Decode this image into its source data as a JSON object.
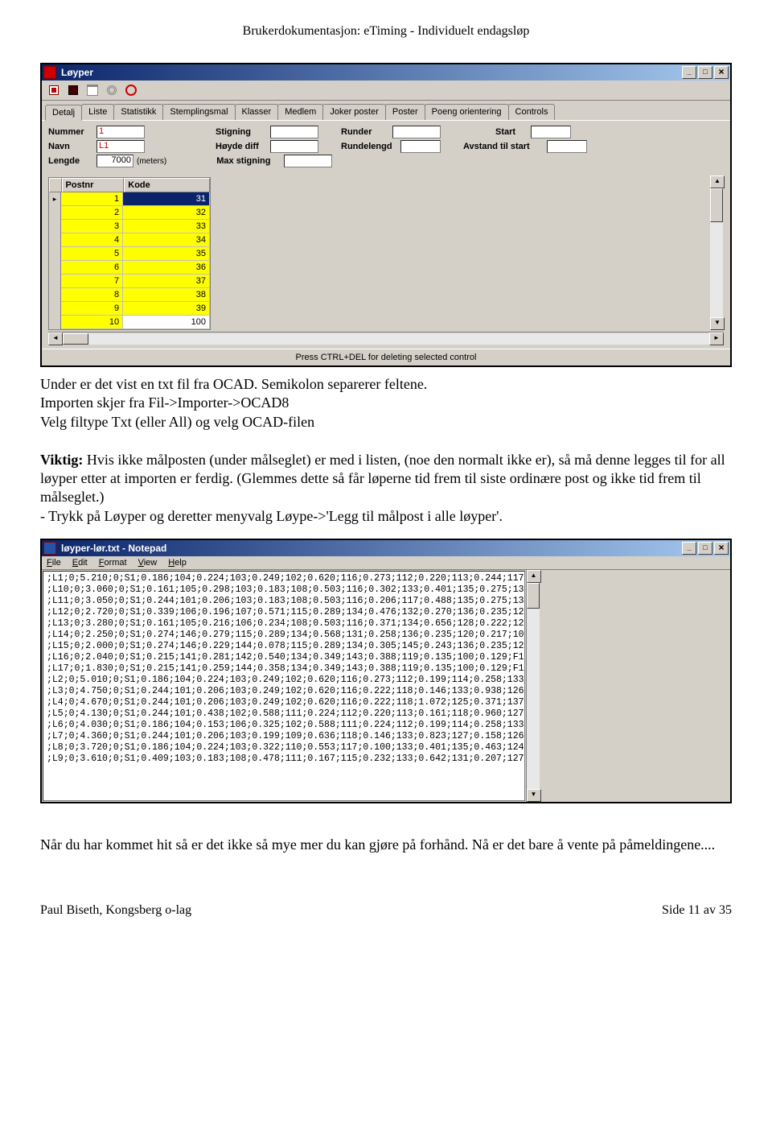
{
  "doc_header": "Brukerdokumentasjon: eTiming - Individuelt endagsløp",
  "win1": {
    "title": "Løyper",
    "tabs": [
      "Detalj",
      "Liste",
      "Statistikk",
      "Stemplingsmal",
      "Klasser",
      "Medlem",
      "Joker poster",
      "Poster",
      "Poeng orientering",
      "Controls"
    ],
    "labels": {
      "nummer": "Nummer",
      "navn": "Navn",
      "lengde": "Lengde",
      "meters": "(meters)",
      "stigning": "Stigning",
      "hoyde": "Høyde diff",
      "maxstig": "Max stigning",
      "runder": "Runder",
      "rundelengd": "Rundelengd",
      "start": "Start",
      "avstand": "Avstand til start"
    },
    "values": {
      "nummer": "1",
      "navn": "L1",
      "lengde": "7000"
    },
    "grid_headers": [
      "Postnr",
      "Kode"
    ],
    "grid_rows": [
      {
        "p": "1",
        "k": "31"
      },
      {
        "p": "2",
        "k": "32"
      },
      {
        "p": "3",
        "k": "33"
      },
      {
        "p": "4",
        "k": "34"
      },
      {
        "p": "5",
        "k": "35"
      },
      {
        "p": "6",
        "k": "36"
      },
      {
        "p": "7",
        "k": "37"
      },
      {
        "p": "8",
        "k": "38"
      },
      {
        "p": "9",
        "k": "39"
      },
      {
        "p": "10",
        "k": "100"
      }
    ],
    "status": "Press CTRL+DEL for deleting selected control"
  },
  "prose1_a": "Under er det vist en txt fil fra OCAD. Semikolon separerer feltene.",
  "prose1_b": "Importen skjer fra Fil->Importer->OCAD8",
  "prose1_c": "Velg filtype Txt (eller All) og velg OCAD-filen",
  "prose1_d": "Viktig:  Hvis ikke målposten (under målseglet) er med i listen, (noe den normalt ikke er), så må denne legges til for all løyper etter at importen er ferdig. (Glemmes dette så får løperne tid frem til siste ordinære post og ikke tid frem til målseglet.)",
  "prose1_e": "- Trykk på Løyper og deretter menyvalg Løype->'Legg til målpost i alle løyper'.",
  "win2": {
    "title": "løyper-lør.txt - Notepad",
    "menu": [
      "File",
      "Edit",
      "Format",
      "View",
      "Help"
    ],
    "lines": [
      ";L1;0;5.210;0;S1;0.186;104;0.224;103;0.249;102;0.620;116;0.273;112;0.220;113;0.244;117",
      ";L10;0;3.060;0;S1;0.161;105;0.298;103;0.183;108;0.503;116;0.302;133;0.401;135;0.275;13",
      ";L11;0;3.050;0;S1;0.244;101;0.206;103;0.183;108;0.503;116;0.206;117;0.488;135;0.275;13",
      ";L12;0;2.720;0;S1;0.339;106;0.196;107;0.571;115;0.289;134;0.476;132;0.270;136;0.235;12",
      ";L13;0;3.280;0;S1;0.161;105;0.216;106;0.234;108;0.503;116;0.371;134;0.656;128;0.222;12",
      ";L14;0;2.250;0;S1;0.274;146;0.279;115;0.289;134;0.568;131;0.258;136;0.235;120;0.217;10",
      ";L15;0;2.000;0;S1;0.274;146;0.229;144;0.078;115;0.289;134;0.305;145;0.243;136;0.235;12",
      ";L16;0;2.040;0;S1;0.215;141;0.281;142;0.540;134;0.349;143;0.388;119;0.135;100;0.129;F1",
      ";L17;0;1.830;0;S1;0.215;141;0.259;144;0.358;134;0.349;143;0.388;119;0.135;100;0.129;F1",
      ";L2;0;5.010;0;S1;0.186;104;0.224;103;0.249;102;0.620;116;0.273;112;0.199;114;0.258;133",
      ";L3;0;4.750;0;S1;0.244;101;0.206;103;0.249;102;0.620;116;0.222;118;0.146;133;0.938;126",
      ";L4;0;4.670;0;S1;0.244;101;0.206;103;0.249;102;0.620;116;0.222;118;1.072;125;0.371;137",
      ";L5;0;4.130;0;S1;0.244;101;0.438;102;0.588;111;0.224;112;0.220;113;0.161;118;0.960;127",
      ";L6;0;4.030;0;S1;0.186;104;0.153;106;0.325;102;0.588;111;0.224;112;0.199;114;0.258;133",
      ";L7;0;4.360;0;S1;0.244;101;0.206;103;0.199;109;0.636;118;0.146;133;0.823;127;0.158;126",
      ";L8;0;3.720;0;S1;0.186;104;0.224;103;0.322;110;0.553;117;0.100;133;0.401;135;0.463;124",
      ";L9;0;3.610;0;S1;0.409;103;0.183;108;0.478;111;0.167;115;0.232;133;0.642;131;0.207;127"
    ]
  },
  "prose2": "Når du har kommet hit så er det ikke så mye mer du kan gjøre på forhånd. Nå er det bare å vente på påmeldingene....",
  "footer_left": "Paul Biseth, Kongsberg o-lag",
  "footer_right": "Side 11 av 35"
}
